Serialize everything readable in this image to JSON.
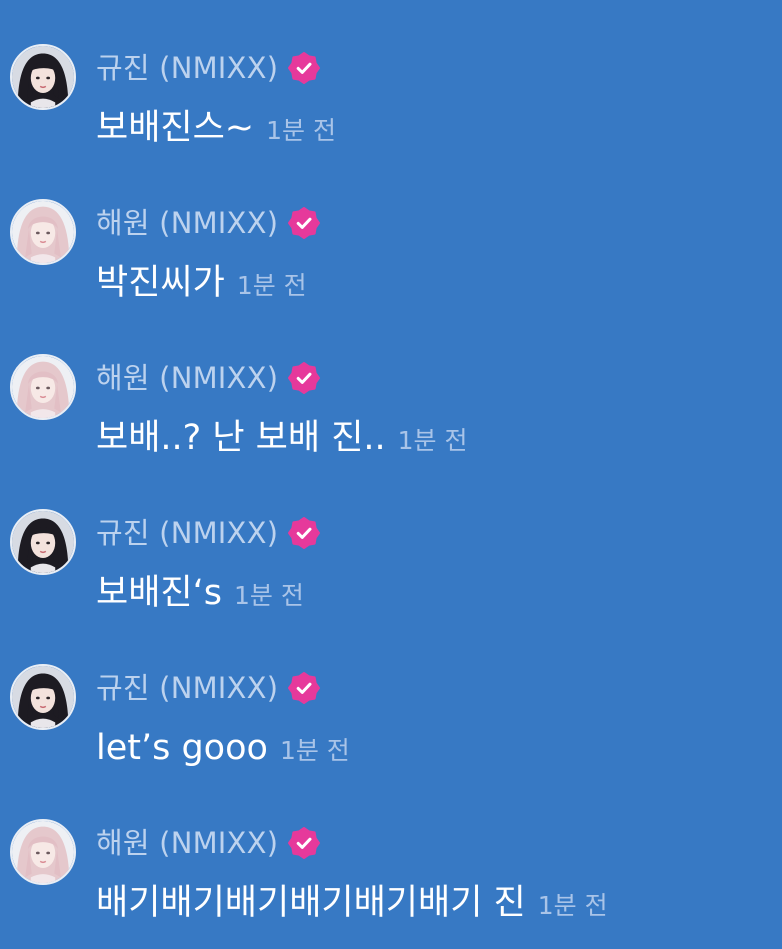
{
  "colors": {
    "background": "#3779c4",
    "name_text": "#bcd2ee",
    "message_text": "#ffffff",
    "timestamp_text": "#a9c4e8",
    "verified_badge": "#e6399b"
  },
  "messages": [
    {
      "sender": "규진 (NMIXX)",
      "avatar": "avatar-dark-hair",
      "verified": true,
      "text": "보배진스~",
      "time": "1분 전"
    },
    {
      "sender": "해원 (NMIXX)",
      "avatar": "avatar-blonde-hair",
      "verified": true,
      "text": "박진씨가",
      "time": "1분 전"
    },
    {
      "sender": "해원 (NMIXX)",
      "avatar": "avatar-blonde-hair",
      "verified": true,
      "text": "보배..? 난 보배 진..",
      "time": "1분 전"
    },
    {
      "sender": "규진 (NMIXX)",
      "avatar": "avatar-dark-hair",
      "verified": true,
      "text": "보배진‘s",
      "time": "1분 전"
    },
    {
      "sender": "규진 (NMIXX)",
      "avatar": "avatar-dark-hair",
      "verified": true,
      "text": "let’s gooo",
      "time": "1분 전"
    },
    {
      "sender": "해원 (NMIXX)",
      "avatar": "avatar-blonde-hair",
      "verified": true,
      "text": "배기배기배기배기배기배기 진",
      "time": "1분 전"
    }
  ]
}
